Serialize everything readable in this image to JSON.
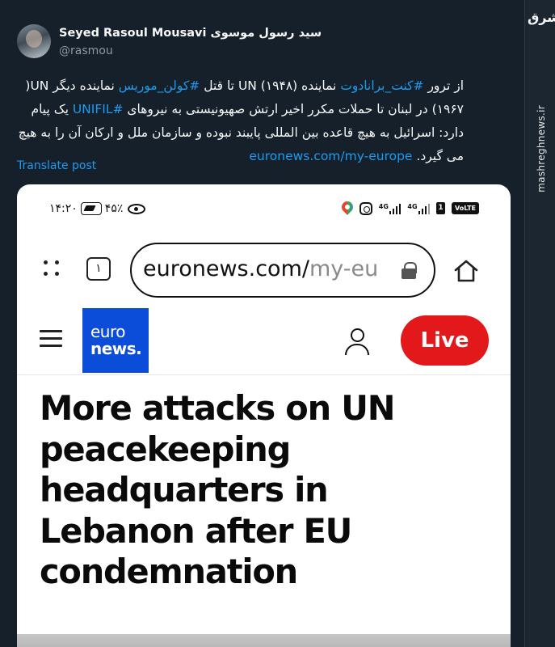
{
  "author": {
    "display_name": "Seyed Rasoul Mousavi سید رسول موسوی",
    "handle": "@rasmou"
  },
  "tweet": {
    "line1_a": "از ترور ",
    "line1_tag1": "#کنت_برانادوت",
    "line1_b": " نماینده UN (۱۹۴۸) تا قتل ",
    "line1_tag2": "#کولن_موریس",
    "line1_c": " نماینده دیگر UN(",
    "line2_a": "۱۹۶۷) در لبنان تا حملات مکرر اخیر ارتش صهیونیستی به نیروهای ",
    "line2_tag": "#UNIFIL",
    "line2_b": " یک پیام",
    "line3": "دارد: اسرائیل به هیچ قاعده بین المللی پایبند نبوده و سازمان ملل و ارکان آن را به هیچ",
    "line4_a": "می گیرد. ",
    "line4_link": "euronews.com/my-europe",
    "translate": "Translate post"
  },
  "watermark": {
    "logo": "مشرق",
    "site": "mashreghnews.ir"
  },
  "screenshot": {
    "status_bar": {
      "time": "۱۴:۲۰",
      "battery": "۴۵٪",
      "net1": "4G",
      "net2": "4G",
      "sim": "1",
      "volte": "VoLTE"
    },
    "browser": {
      "tab_count": "۱",
      "url_main": "euronews.com/",
      "url_dim": "my-eu"
    },
    "site": {
      "logo_top": "euro",
      "logo_bottom": "news.",
      "live_label": "Live"
    },
    "headline": "More attacks on UN peacekeeping headquarters in Lebanon after EU condemnation"
  }
}
